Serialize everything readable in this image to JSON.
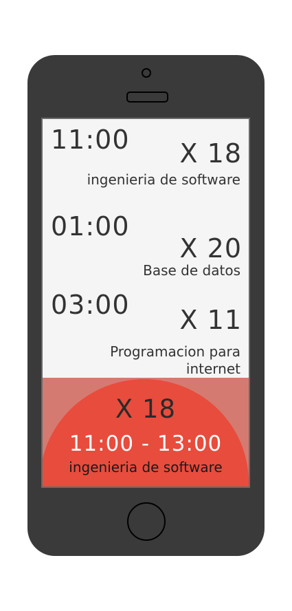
{
  "schedule": [
    {
      "time": "11:00",
      "code": "X 18",
      "name": "ingenieria de software"
    },
    {
      "time": "01:00",
      "code": "X 20",
      "name": "Base de datos"
    },
    {
      "time": "03:00",
      "code": "X 11",
      "name": "Programacion para internet"
    }
  ],
  "current": {
    "code": "X 18",
    "range": "11:00 - 13:00",
    "name": "ingenieria de software"
  },
  "colors": {
    "accent": "#e84c3d",
    "accent_bg": "#d57a70",
    "phone_body": "#3a3a3a",
    "screen_bg": "#f5f5f5"
  }
}
